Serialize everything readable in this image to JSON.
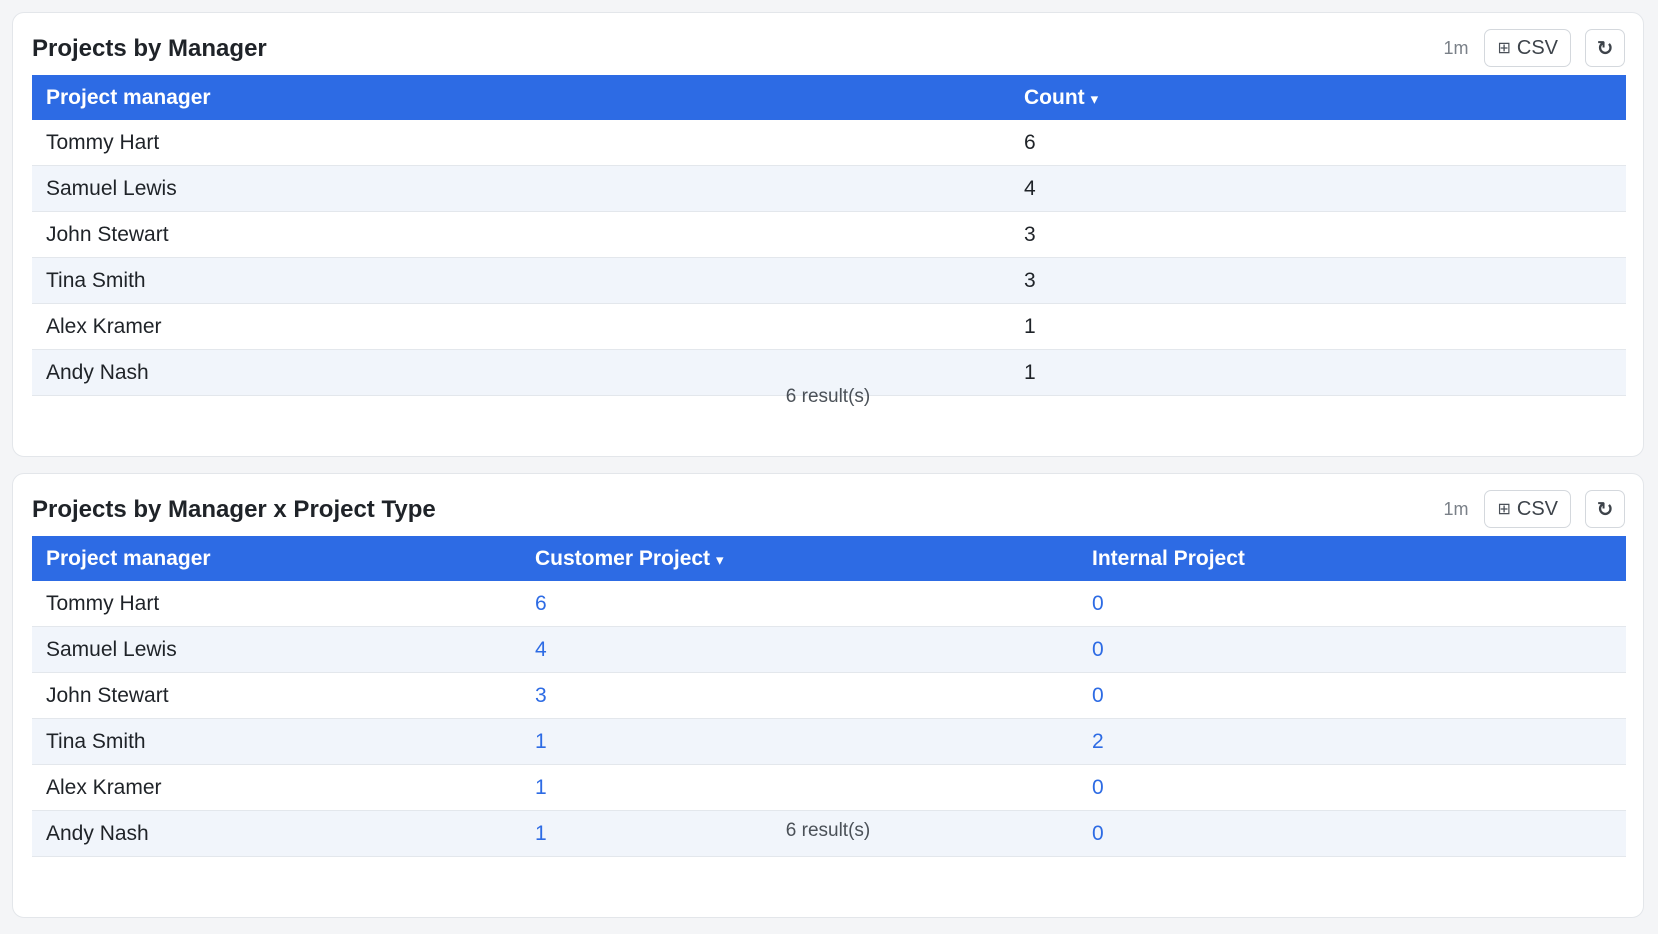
{
  "panels": [
    {
      "title": "Projects by Manager",
      "refresh_age": "1m",
      "csv_label": "CSV",
      "refresh_icon": "↻",
      "grid_icon": "⊞",
      "columns": [
        "Project manager",
        "Count"
      ],
      "sorted_column_indicator": "▾",
      "rows": [
        [
          "Tommy Hart",
          "6"
        ],
        [
          "Samuel Lewis",
          "4"
        ],
        [
          "John Stewart",
          "3"
        ],
        [
          "Tina Smith",
          "3"
        ],
        [
          "Alex Kramer",
          "1"
        ],
        [
          "Andy Nash",
          "1"
        ]
      ],
      "result_count": "6 result(s)"
    },
    {
      "title": "Projects by Manager x Project Type",
      "refresh_age": "1m",
      "csv_label": "CSV",
      "refresh_icon": "↻",
      "grid_icon": "⊞",
      "columns": [
        "Project manager",
        "Customer Project",
        "Internal Project"
      ],
      "sorted_column_indicator": "▾",
      "rows": [
        [
          "Tommy Hart",
          "6",
          "0"
        ],
        [
          "Samuel Lewis",
          "4",
          "0"
        ],
        [
          "John Stewart",
          "3",
          "0"
        ],
        [
          "Tina Smith",
          "1",
          "2"
        ],
        [
          "Alex Kramer",
          "1",
          "0"
        ],
        [
          "Andy Nash",
          "1",
          "0"
        ]
      ],
      "result_count": "6 result(s)"
    }
  ],
  "colors": {
    "header_bg": "#2d6be4",
    "link": "#2d6be4",
    "row_alt": "#f1f5fb"
  }
}
